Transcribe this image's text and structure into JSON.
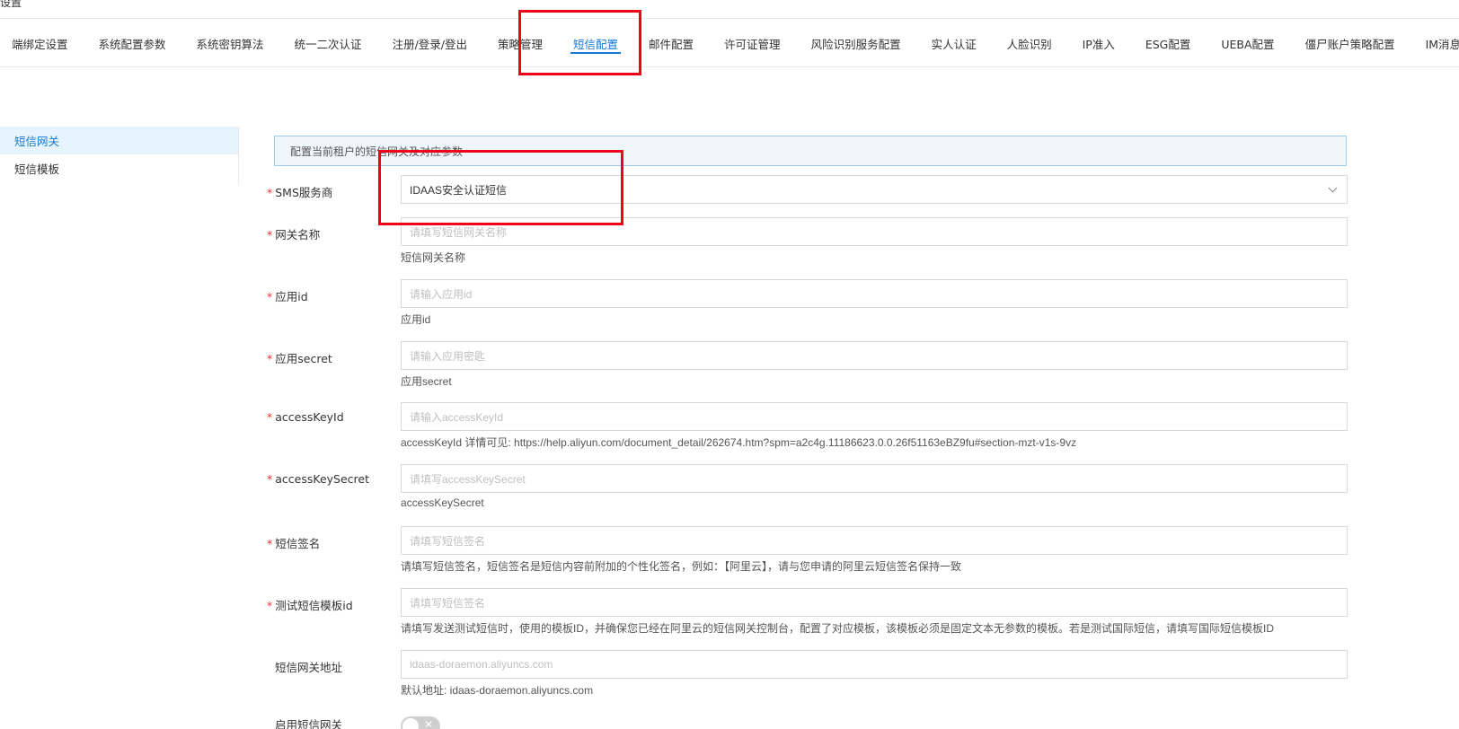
{
  "header": {
    "title_fragment": "设置"
  },
  "tabs": [
    {
      "label": "端绑定设置"
    },
    {
      "label": "系统配置参数"
    },
    {
      "label": "系统密钥算法"
    },
    {
      "label": "统一二次认证"
    },
    {
      "label": "注册/登录/登出"
    },
    {
      "label": "策略管理"
    },
    {
      "label": "短信配置",
      "active": true
    },
    {
      "label": "邮件配置"
    },
    {
      "label": "许可证管理"
    },
    {
      "label": "风险识别服务配置"
    },
    {
      "label": "实人认证"
    },
    {
      "label": "人脸识别"
    },
    {
      "label": "IP准入"
    },
    {
      "label": "ESG配置"
    },
    {
      "label": "UEBA配置"
    },
    {
      "label": "僵尸账户策略配置"
    },
    {
      "label": "IM消息免登"
    }
  ],
  "sidebar": {
    "items": [
      {
        "label": "短信网关",
        "active": true
      },
      {
        "label": "短信模板"
      }
    ]
  },
  "notice": {
    "text": "配置当前租户的短信网关及对应参数"
  },
  "form": {
    "sms_provider": {
      "label": "SMS服务商",
      "value": "IDAAS安全认证短信"
    },
    "gateway_name": {
      "label": "网关名称",
      "placeholder": "请填写短信网关名称",
      "help": "短信网关名称"
    },
    "app_id": {
      "label": "应用id",
      "placeholder": "请输入应用id",
      "help": "应用id"
    },
    "app_secret": {
      "label": "应用secret",
      "placeholder": "请输入应用密匙",
      "help": "应用secret"
    },
    "access_key_id": {
      "label": "accessKeyId",
      "placeholder": "请输入accessKeyId",
      "help": "accessKeyId 详情可见: https://help.aliyun.com/document_detail/262674.htm?spm=a2c4g.11186623.0.0.26f51163eBZ9fu#section-mzt-v1s-9vz"
    },
    "access_key_secret": {
      "label": "accessKeySecret",
      "placeholder": "请填写accessKeySecret",
      "help": "accessKeySecret"
    },
    "sms_signature": {
      "label": "短信签名",
      "placeholder": "请填写短信签名",
      "help": "请填写短信签名，短信签名是短信内容前附加的个性化签名，例如：【阿里云】，请与您申请的阿里云短信签名保持一致"
    },
    "test_template_id": {
      "label": "测试短信模板id",
      "placeholder": "请填写短信签名",
      "help": "请填写发送测试短信时，使用的模板ID，并确保您已经在阿里云的短信网关控制台，配置了对应模板，该模板必须是固定文本无参数的模板。若是测试国际短信，请填写国际短信模板ID"
    },
    "gateway_address": {
      "label": "短信网关地址",
      "placeholder": "idaas-doraemon.aliyuncs.com",
      "help": "默认地址: idaas-doraemon.aliyuncs.com"
    },
    "enable_gateway": {
      "label": "启用短信网关",
      "enabled": false
    }
  },
  "colors": {
    "accent": "#1677d2",
    "highlight": "#f00016",
    "required": "#e8322e"
  }
}
